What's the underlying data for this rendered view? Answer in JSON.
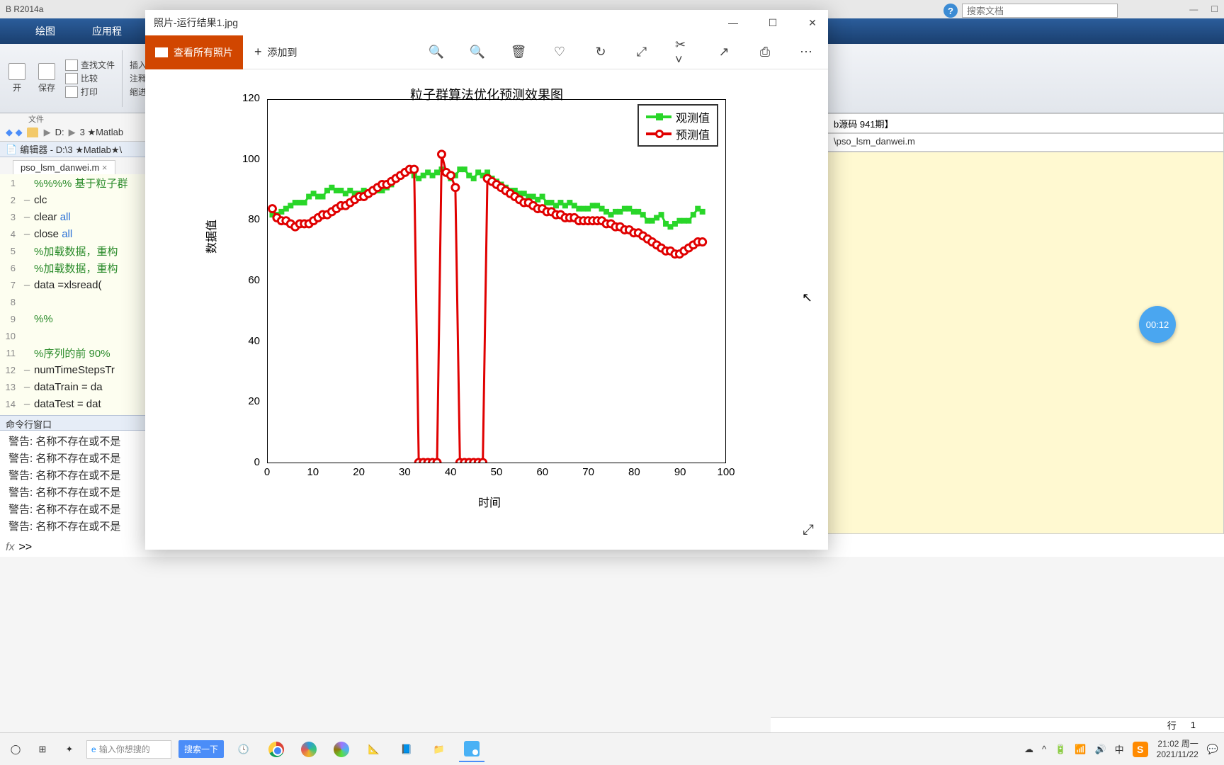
{
  "matlab": {
    "title": "B R2014a",
    "ribbon": {
      "tabs": [
        "绘图",
        "应用程"
      ]
    },
    "toolstrip": {
      "open": "开",
      "save": "保存",
      "find_files": "查找文件",
      "compare": "比较",
      "print": "打印",
      "insert": "插入",
      "comment": "注释",
      "indent": "缩进",
      "group_label": "文件"
    },
    "path": {
      "drive": "D:",
      "seg1": "3 ★Matlab"
    },
    "editor_title": "编辑器 - D:\\3 ★Matlab★\\",
    "tab_file": "pso_lsm_danwei.m",
    "code": [
      {
        "n": "1",
        "mark": "",
        "cls": "comment",
        "txt": "%%%% 基于粒子群"
      },
      {
        "n": "2",
        "mark": "–",
        "cls": "plain",
        "txt": "clc"
      },
      {
        "n": "3",
        "mark": "–",
        "cls": "plain",
        "txt": "clear <kw>all</kw>"
      },
      {
        "n": "4",
        "mark": "–",
        "cls": "plain",
        "txt": "close <kw>all</kw>"
      },
      {
        "n": "5",
        "mark": "",
        "cls": "comment",
        "txt": "%加载数据，重构"
      },
      {
        "n": "6",
        "mark": "",
        "cls": "comment",
        "txt": "%加载数据，重构"
      },
      {
        "n": "7",
        "mark": "–",
        "cls": "plain",
        "txt": "data =xlsread("
      },
      {
        "n": "8",
        "mark": "",
        "cls": "plain",
        "txt": ""
      },
      {
        "n": "9",
        "mark": "",
        "cls": "comment",
        "txt": "%%"
      },
      {
        "n": "10",
        "mark": "",
        "cls": "plain",
        "txt": ""
      },
      {
        "n": "11",
        "mark": "",
        "cls": "comment",
        "txt": "%序列的前 90%"
      },
      {
        "n": "12",
        "mark": "–",
        "cls": "plain",
        "txt": "numTimeStepsTr"
      },
      {
        "n": "13",
        "mark": "–",
        "cls": "plain",
        "txt": "dataTrain = da"
      },
      {
        "n": "14",
        "mark": "–",
        "cls": "plain",
        "txt": "dataTest = dat"
      }
    ],
    "cmd_title": "命令行窗口",
    "cmd_warn_prefix": "警告:",
    "cmd_warn_msg": "名称不存在或不是",
    "prompt_fx": "fx",
    "prompt": ">>",
    "right_panel1": "b源码 941期】",
    "right_panel2": "\\pso_lsm_danwei.m",
    "search_placeholder": "搜索文档",
    "status_row": "行",
    "status_row_val": "1"
  },
  "photos": {
    "title_prefix": "照片",
    "title_sep": " - ",
    "title_file": "运行结果1.jpg",
    "back_label": "查看所有照片",
    "add_label": "添加到"
  },
  "chart_data": {
    "type": "line",
    "title": "粒子群算法优化预测效果图",
    "xlabel": "时间",
    "ylabel": "数据值",
    "xlim": [
      0,
      100
    ],
    "ylim": [
      0,
      120
    ],
    "xticks": [
      0,
      10,
      20,
      30,
      40,
      50,
      60,
      70,
      80,
      90,
      100
    ],
    "yticks": [
      0,
      20,
      40,
      60,
      80,
      100,
      120
    ],
    "legend": {
      "observed": "观测值",
      "predicted": "预测值"
    },
    "series": [
      {
        "name": "观测值",
        "style": "green-square",
        "x": [
          1,
          2,
          3,
          4,
          5,
          6,
          7,
          8,
          9,
          10,
          11,
          12,
          13,
          14,
          15,
          16,
          17,
          18,
          19,
          20,
          21,
          22,
          23,
          24,
          25,
          26,
          27,
          28,
          29,
          30,
          31,
          32,
          33,
          34,
          35,
          36,
          37,
          38,
          39,
          40,
          41,
          42,
          43,
          44,
          45,
          46,
          47,
          48,
          49,
          50,
          51,
          52,
          53,
          54,
          55,
          56,
          57,
          58,
          59,
          60,
          61,
          62,
          63,
          64,
          65,
          66,
          67,
          68,
          69,
          70,
          71,
          72,
          73,
          74,
          75,
          76,
          77,
          78,
          79,
          80,
          81,
          82,
          83,
          84,
          85,
          86,
          87,
          88,
          89,
          90,
          91,
          92,
          93,
          94,
          95
        ],
        "y": [
          82,
          82,
          83,
          84,
          85,
          86,
          86,
          86,
          88,
          89,
          88,
          88,
          90,
          91,
          90,
          90,
          89,
          90,
          89,
          89,
          90,
          89,
          90,
          90,
          90,
          91,
          92,
          94,
          95,
          96,
          97,
          95,
          94,
          95,
          96,
          95,
          96,
          97,
          96,
          94,
          95,
          97,
          97,
          95,
          94,
          96,
          95,
          96,
          94,
          93,
          92,
          91,
          90,
          90,
          89,
          89,
          88,
          88,
          87,
          88,
          86,
          86,
          85,
          86,
          85,
          86,
          85,
          84,
          84,
          84,
          85,
          85,
          84,
          83,
          82,
          83,
          83,
          84,
          84,
          83,
          83,
          82,
          80,
          80,
          81,
          82,
          79,
          78,
          79,
          80,
          80,
          80,
          82,
          84,
          83
        ]
      },
      {
        "name": "预测值",
        "style": "red-circle",
        "x": [
          1,
          2,
          3,
          4,
          5,
          6,
          7,
          8,
          9,
          10,
          11,
          12,
          13,
          14,
          15,
          16,
          17,
          18,
          19,
          20,
          21,
          22,
          23,
          24,
          25,
          26,
          27,
          28,
          29,
          30,
          31,
          32,
          33,
          34,
          35,
          36,
          37,
          38,
          39,
          40,
          41,
          42,
          43,
          44,
          45,
          46,
          47,
          48,
          49,
          50,
          51,
          52,
          53,
          54,
          55,
          56,
          57,
          58,
          59,
          60,
          61,
          62,
          63,
          64,
          65,
          66,
          67,
          68,
          69,
          70,
          71,
          72,
          73,
          74,
          75,
          76,
          77,
          78,
          79,
          80,
          81,
          82,
          83,
          84,
          85,
          86,
          87,
          88,
          89,
          90,
          91,
          92,
          93,
          94,
          95
        ],
        "y": [
          84,
          81,
          80,
          80,
          79,
          78,
          79,
          79,
          79,
          80,
          81,
          82,
          82,
          83,
          84,
          85,
          85,
          86,
          87,
          88,
          88,
          89,
          90,
          91,
          92,
          92,
          93,
          94,
          95,
          96,
          97,
          97,
          0,
          0,
          0,
          0,
          0,
          102,
          96,
          95,
          91,
          0,
          0,
          0,
          0,
          0,
          0,
          94,
          93,
          92,
          91,
          90,
          89,
          88,
          87,
          86,
          86,
          85,
          84,
          84,
          83,
          83,
          82,
          82,
          81,
          81,
          81,
          80,
          80,
          80,
          80,
          80,
          80,
          79,
          79,
          78,
          78,
          77,
          77,
          76,
          76,
          75,
          74,
          73,
          72,
          71,
          70,
          70,
          69,
          69,
          70,
          71,
          72,
          73,
          73
        ]
      }
    ]
  },
  "timer": "00:12",
  "taskbar": {
    "search_placeholder": "输入你想搜的",
    "search_btn": "搜索一下",
    "clock_time": "21:02",
    "clock_day": "周一",
    "clock_date": "2021/11/22"
  }
}
